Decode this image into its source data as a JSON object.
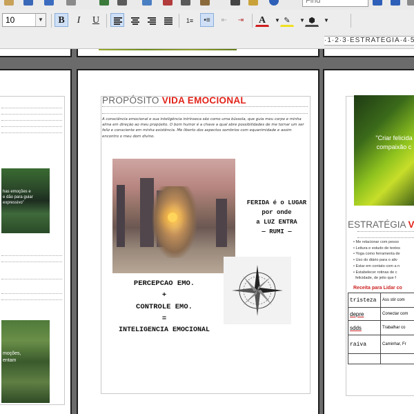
{
  "toolbar": {
    "find_placeholder": "Find",
    "font_size": "10",
    "bold": "B",
    "italic": "I",
    "underline": "U",
    "font_color_letter": "A"
  },
  "ruler": {
    "text": "·1·2·3·ESTRATÉGIA·4·5·"
  },
  "page_center": {
    "title_part1": "PROPÓSITO ",
    "title_part2": "VIDA EMOCIONAL",
    "intro": "A consciência emocional e sua inteligência intrínseca são como uma bússola, que guia meu corpo e minha alma em direção ao meu propósito. O bom humor é a chave a qual abre possibilidades de me tornar um ser feliz e consciente em minha existência. Me liberto dos aspectos sombrios com equanimidade e assim encontro o meu dom divino.",
    "quote_line1": "FERIDA é o LUGAR",
    "quote_line2": "por onde",
    "quote_line3": "a LUZ ENTRA",
    "quote_line4": "— RUMI —",
    "formula_line1": "PERCEPCAO EMO.",
    "formula_line2": "+",
    "formula_line3": "CONTROLE EMO.",
    "formula_line4": "=",
    "formula_line5": "INTELIGENCIA EMOCIONAL"
  },
  "page_left": {
    "photo1_caption": "has emoções e\n e dão para guiar\nexpressivo\"",
    "photo2_caption": "moções,\nentam"
  },
  "page_right": {
    "quote_line1": "\"Criar felicida",
    "quote_line2": "compaixão c",
    "title_part1": "ESTRATÉGIA ",
    "title_part2": "V",
    "bullets": [
      "Me relacionar com pesso",
      "Leitura e estudo de textos",
      "Yoga como ferramenta de",
      "Uso do diário para o aliv",
      "Estar em contato com a n",
      "Estabelecer rotinas de c",
      "felicidade, de jeito que f"
    ],
    "recipe_title": "Receita para Lidar co",
    "recipe_rows": [
      [
        "tristeza",
        "Ass stir com"
      ],
      [
        "depre",
        "Conectar com"
      ],
      [
        "sdds",
        "Trabalhar co"
      ],
      [
        "raiva",
        "Caminhar, Fr"
      ],
      [
        "",
        ""
      ]
    ]
  },
  "colors": {
    "accent_red": "#e2231a",
    "title_gray": "#666666"
  }
}
